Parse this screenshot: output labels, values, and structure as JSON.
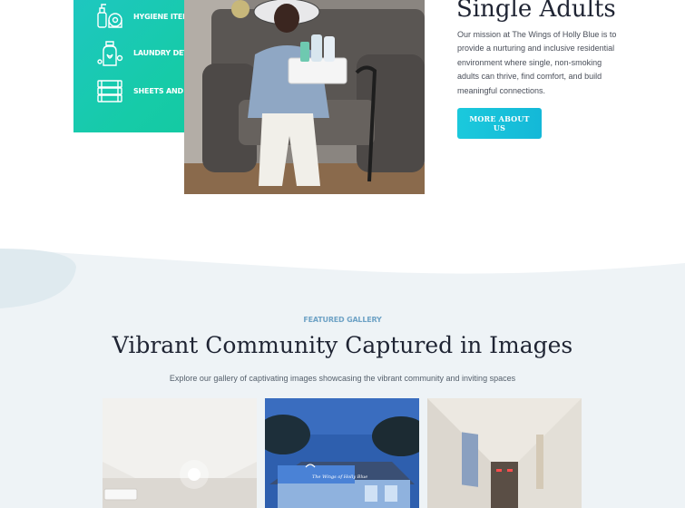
{
  "amenities": [
    {
      "label": "HYGIENE ITEMS",
      "icon": "hygiene-items-icon"
    },
    {
      "label": "LAUNDRY DETERGENT",
      "icon": "laundry-detergent-icon"
    },
    {
      "label": "SHEETS AND LINENS",
      "icon": "sheets-linens-icon"
    }
  ],
  "intro": {
    "title": "Single Adults",
    "body": "Our mission at The Wings of Holly Blue is to provide a nurturing and inclusive residential environment where single, non-smoking adults can thrive, find comfort, and build meaningful connections.",
    "cta": "MORE ABOUT US"
  },
  "gallery": {
    "eyebrow": "FEATURED GALLERY",
    "title": "Vibrant Community Captured in Images",
    "subtitle": "Explore our gallery of captivating images showcasing the vibrant community and inviting spaces",
    "house_sign": "The Wings of Holly Blue"
  },
  "colors": {
    "teal_card": "#16cba8",
    "cta": "#1bc9dc",
    "eyebrow": "#6fa3c6",
    "section_bg": "#eef3f6"
  }
}
